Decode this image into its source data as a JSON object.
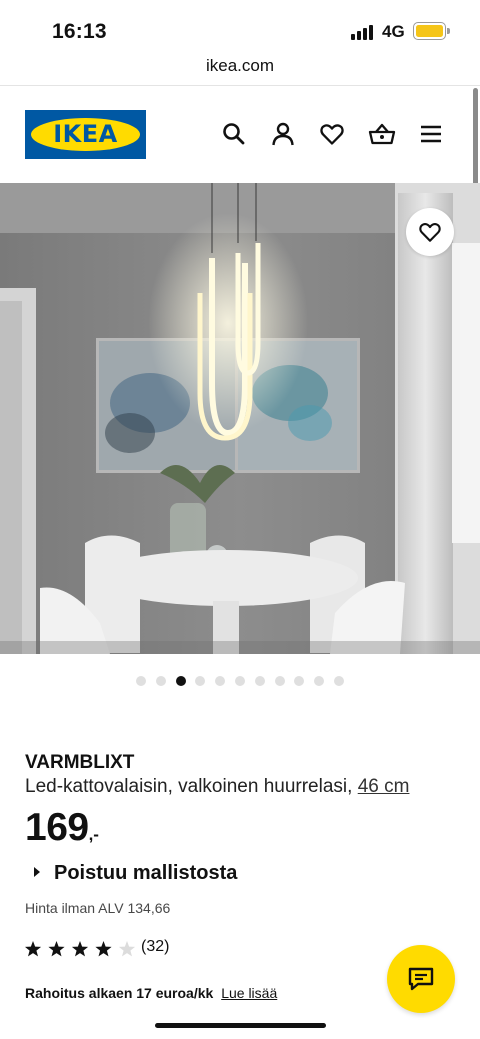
{
  "status_bar": {
    "time": "16:13",
    "network": "4G"
  },
  "browser": {
    "url": "ikea.com"
  },
  "header": {
    "logo_text": "IKEA",
    "icons": [
      "search-icon",
      "account-icon",
      "favourites-icon",
      "basket-icon",
      "menu-icon"
    ]
  },
  "gallery": {
    "image_count": 11,
    "active_index": 2
  },
  "product": {
    "name": "VARMBLIXT",
    "description": "Led-kattovalaisin, valkoinen huurrelasi,",
    "size_link": "46 cm",
    "price_integer": "169",
    "price_suffix": ",-",
    "discontinued_label": "Poistuu mallistosta",
    "price_without_vat": "Hinta ilman ALV 134,66",
    "rating_value": 4,
    "rating_max": 5,
    "review_count": "(32)",
    "financing_text": "Rahoitus alkaen 17 euroa/kk",
    "financing_link": "Lue lisää"
  },
  "colors": {
    "ikea_blue": "#0058a3",
    "ikea_yellow": "#ffdb00",
    "battery": "#f5c518"
  }
}
